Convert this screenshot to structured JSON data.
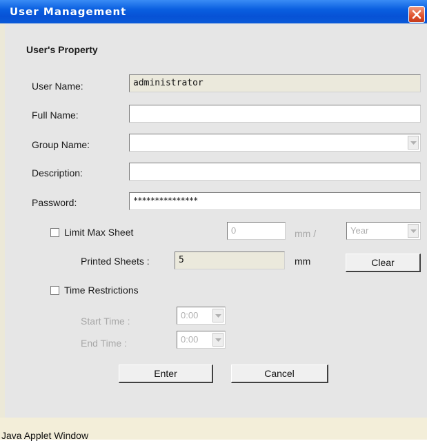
{
  "window": {
    "title": "User Management"
  },
  "form": {
    "section_title": "User's Property",
    "user_name": {
      "label": "User Name:",
      "value": "administrator"
    },
    "full_name": {
      "label": "Full Name:",
      "value": ""
    },
    "group_name": {
      "label": "Group Name:",
      "value": ""
    },
    "description": {
      "label": "Description:",
      "value": ""
    },
    "password": {
      "label": "Password:",
      "value": "***************"
    }
  },
  "limit": {
    "checkbox_label": "Limit Max Sheet",
    "checked": false,
    "max_value": "0",
    "unit_per": "mm /",
    "period": "Year",
    "printed_label": "Printed Sheets :",
    "printed_value": "5",
    "printed_unit": "mm",
    "clear_label": "Clear"
  },
  "time": {
    "checkbox_label": "Time Restrictions",
    "checked": false,
    "start_label": "Start Time :",
    "start_value": "0:00",
    "end_label": "End Time :",
    "end_value": "0:00"
  },
  "buttons": {
    "enter": "Enter",
    "cancel": "Cancel"
  },
  "status": "Java Applet Window",
  "colors": {
    "titlebar": "#0752d6",
    "close": "#e0532f",
    "panel": "#e6e6e6",
    "status": "#f3eed9"
  },
  "icons": [
    "close-icon",
    "chevron-down-icon"
  ]
}
